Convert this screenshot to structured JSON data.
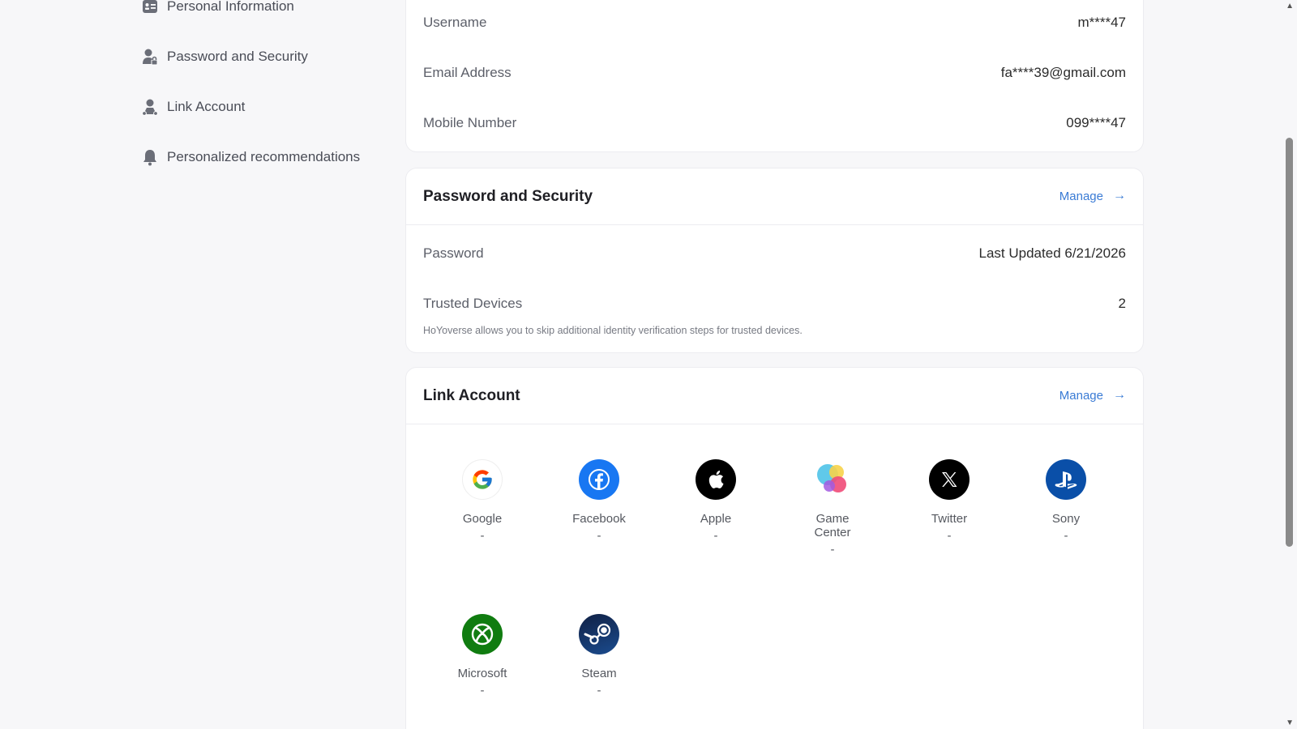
{
  "sidebar": {
    "items": [
      {
        "label": "Personal Information",
        "icon": "id-card-icon"
      },
      {
        "label": "Password and Security",
        "icon": "lock-person-icon"
      },
      {
        "label": "Link Account",
        "icon": "link-person-icon"
      },
      {
        "label": "Personalized recommendations",
        "icon": "bell-icon"
      }
    ]
  },
  "personal": {
    "rows": [
      {
        "key": "Username",
        "value": "m****47"
      },
      {
        "key": "Email Address",
        "value": "fa****39@gmail.com"
      },
      {
        "key": "Mobile Number",
        "value": "099****47"
      }
    ]
  },
  "security": {
    "title": "Password and Security",
    "manage": "Manage",
    "password_label": "Password",
    "password_value": "Last Updated 6/21/2026",
    "devices_label": "Trusted Devices",
    "devices_value": "2",
    "devices_note": "HoYoverse allows you to skip additional identity verification steps for trusted devices."
  },
  "link": {
    "title": "Link Account",
    "manage": "Manage",
    "accounts": [
      {
        "name": "Google",
        "status": "-",
        "icon": "google-icon"
      },
      {
        "name": "Facebook",
        "status": "-",
        "icon": "facebook-icon"
      },
      {
        "name": "Apple",
        "status": "-",
        "icon": "apple-icon"
      },
      {
        "name": "Game Center",
        "status": "-",
        "icon": "game-center-icon"
      },
      {
        "name": "Twitter",
        "status": "-",
        "icon": "x-twitter-icon"
      },
      {
        "name": "Sony",
        "status": "-",
        "icon": "playstation-icon"
      },
      {
        "name": "Microsoft",
        "status": "-",
        "icon": "xbox-icon"
      },
      {
        "name": "Steam",
        "status": "-",
        "icon": "steam-icon"
      }
    ]
  },
  "colors": {
    "accent": "#3a7bd5",
    "facebook": "#1877f2",
    "sony": "#0a4fa8",
    "microsoft": "#107c10",
    "steam": "#1b2f5a"
  }
}
